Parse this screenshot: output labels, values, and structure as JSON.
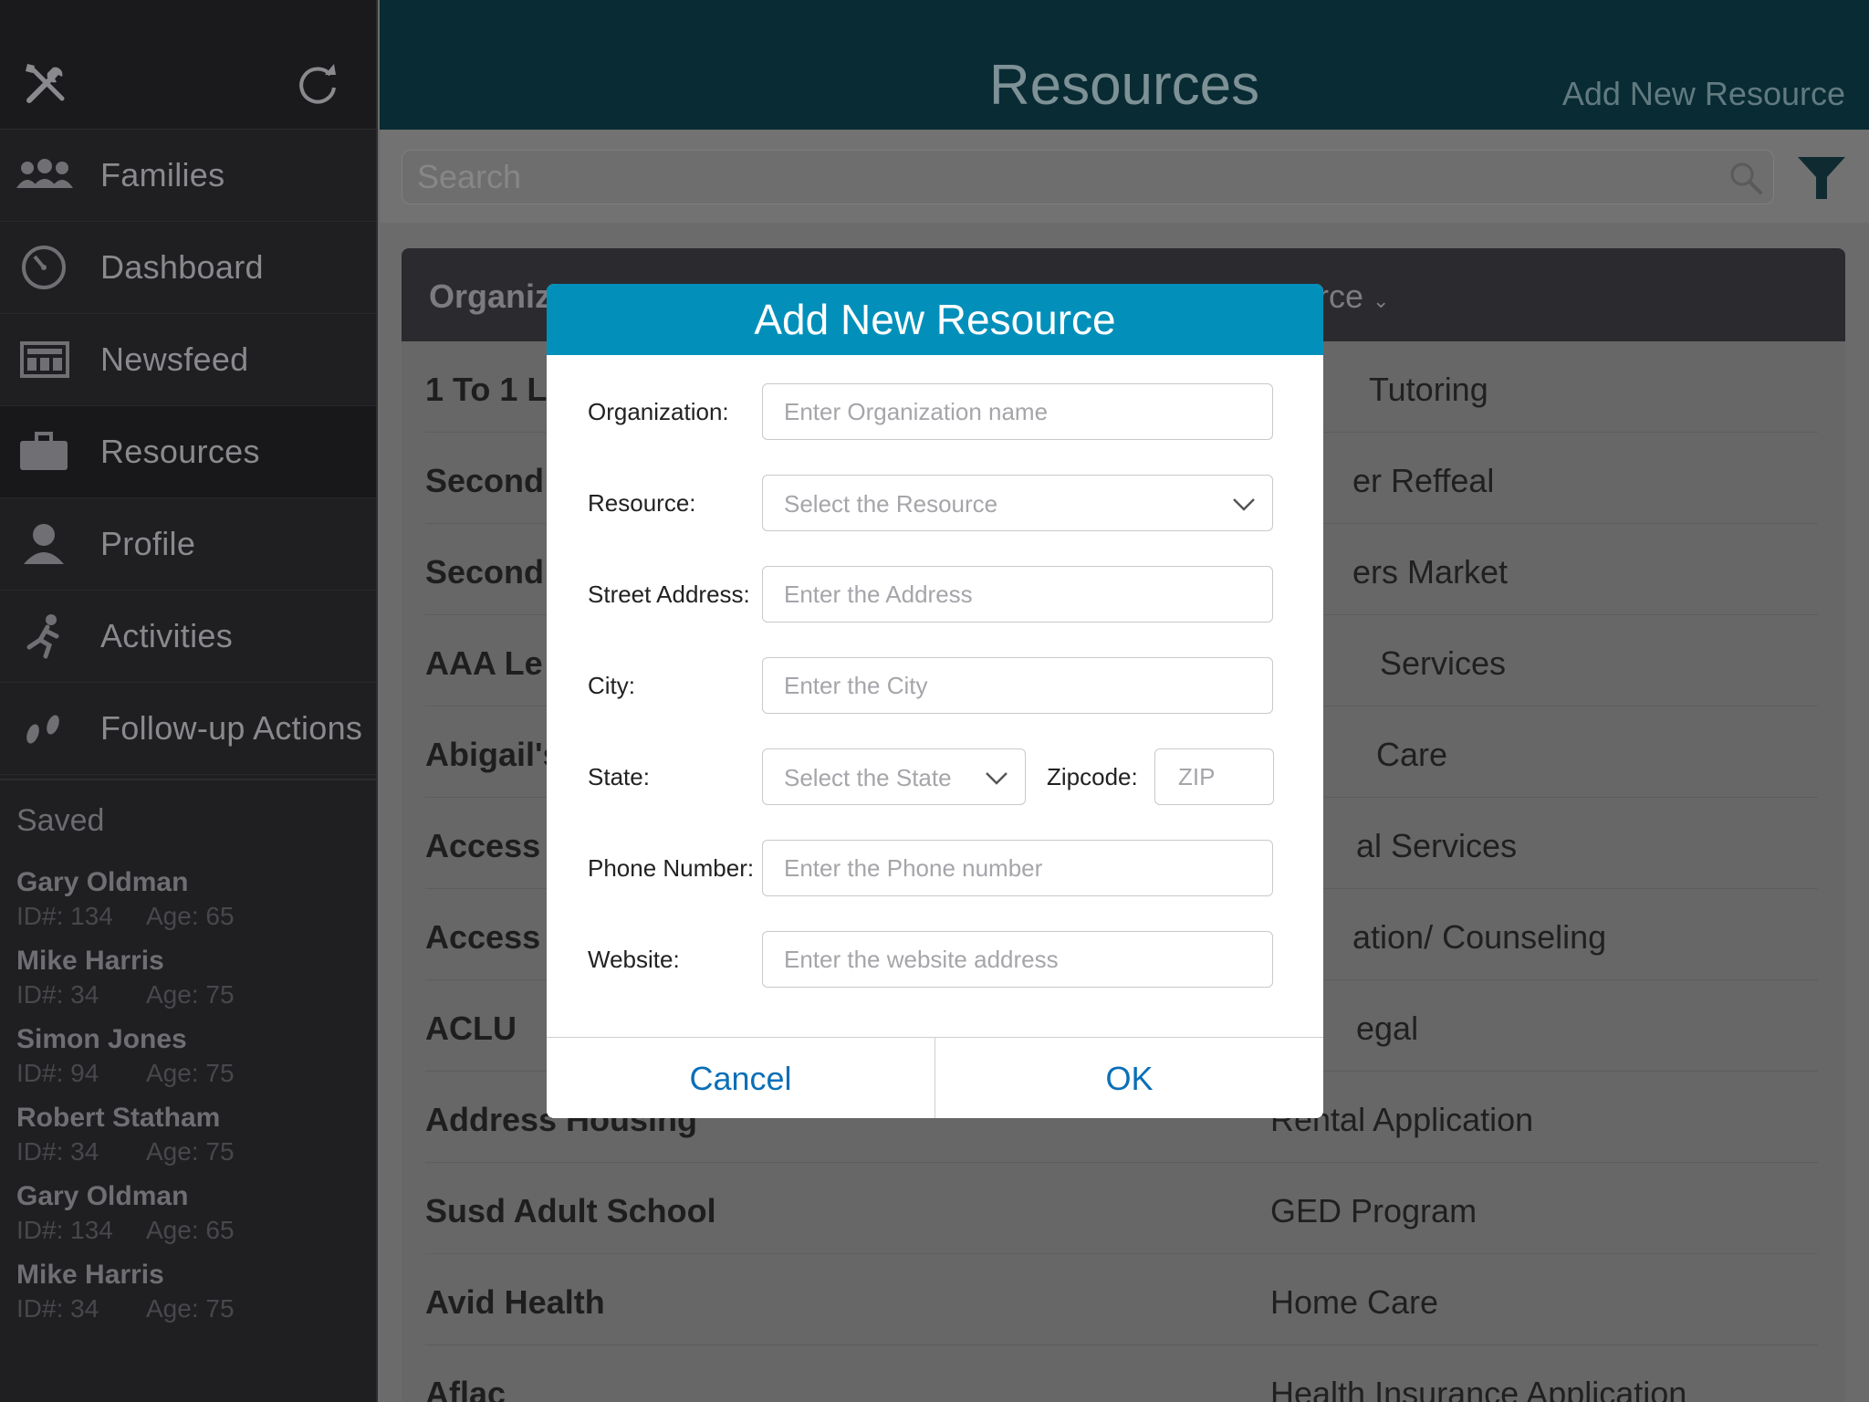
{
  "app": {
    "title": "Resources",
    "add_link": "Add New Resource"
  },
  "sidebar": {
    "items": [
      {
        "label": "Families",
        "icon": "families-icon"
      },
      {
        "label": "Dashboard",
        "icon": "dashboard-icon"
      },
      {
        "label": "Newsfeed",
        "icon": "newsfeed-icon"
      },
      {
        "label": "Resources",
        "icon": "briefcase-icon",
        "active": true
      },
      {
        "label": "Profile",
        "icon": "profile-icon"
      },
      {
        "label": "Activities",
        "icon": "running-icon"
      },
      {
        "label": "Follow-up Actions",
        "icon": "footprints-icon"
      }
    ],
    "saved_header": "Saved",
    "saved": [
      {
        "name": "Gary Oldman",
        "id": "ID#: 134",
        "age": "Age: 65"
      },
      {
        "name": "Mike Harris",
        "id": "ID#: 34",
        "age": "Age: 75"
      },
      {
        "name": "Simon Jones",
        "id": "ID#: 94",
        "age": "Age: 75"
      },
      {
        "name": "Robert Statham",
        "id": "ID#: 34",
        "age": "Age: 75"
      },
      {
        "name": "Gary Oldman",
        "id": "ID#: 134",
        "age": "Age: 65"
      },
      {
        "name": "Mike Harris",
        "id": "ID#: 34",
        "age": "Age: 75"
      }
    ]
  },
  "search": {
    "placeholder": "Search"
  },
  "table": {
    "col_org": "Organiz",
    "col_res": "urce",
    "rows": [
      {
        "org": "1 To 1 L",
        "res": "Tutoring"
      },
      {
        "org": "Second",
        "res": "er Reffeal"
      },
      {
        "org": "Second",
        "res": "ers Market"
      },
      {
        "org": "AAA Le",
        "res": "Services"
      },
      {
        "org": "Abigail's",
        "res": "Care"
      },
      {
        "org": "Access",
        "res": "al Services"
      },
      {
        "org": "Access",
        "res": "ation/ Counseling"
      },
      {
        "org": "ACLU",
        "res": "egal"
      },
      {
        "org": "Address Housing",
        "res": "Rental Application"
      },
      {
        "org": "Susd Adult School",
        "res": "GED Program"
      },
      {
        "org": "Avid Health",
        "res": "Home Care"
      },
      {
        "org": "Aflac",
        "res": "Health Insurance Application"
      }
    ]
  },
  "modal": {
    "title": "Add New Resource",
    "organization": {
      "label": "Organization:",
      "placeholder": "Enter Organization name"
    },
    "resource": {
      "label": "Resource:",
      "placeholder": "Select the Resource"
    },
    "street": {
      "label": "Street Address:",
      "placeholder": "Enter the Address"
    },
    "city": {
      "label": "City:",
      "placeholder": "Enter the City"
    },
    "state": {
      "label": "State:",
      "placeholder": "Select the State"
    },
    "zip": {
      "label": "Zipcode:",
      "placeholder": "ZIP"
    },
    "phone": {
      "label": "Phone Number:",
      "placeholder": "Enter the Phone number"
    },
    "website": {
      "label": "Website:",
      "placeholder": "Enter the website address"
    },
    "cancel": "Cancel",
    "ok": "OK"
  },
  "colors": {
    "accent": "#0290bb",
    "topbar": "#092b33",
    "button_text": "#0a6fb7"
  }
}
